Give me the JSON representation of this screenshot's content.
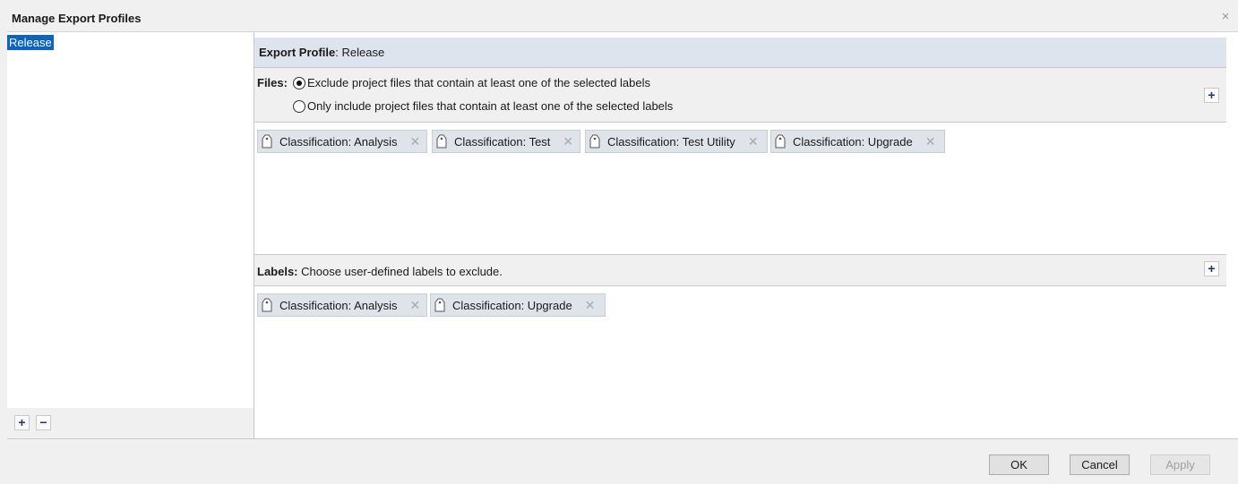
{
  "dialog": {
    "title": "Manage Export Profiles",
    "close_glyph": "×"
  },
  "profiles": {
    "items": [
      {
        "label": "Release",
        "selected": true
      }
    ],
    "add_glyph": "+",
    "remove_glyph": "−"
  },
  "export_profile": {
    "heading": "Export Profile",
    "separator": ":",
    "name": " Release"
  },
  "files": {
    "label": "Files:",
    "options": [
      {
        "label": "Exclude project files that contain at least one of the selected labels",
        "checked": true
      },
      {
        "label": "Only include project files that contain at least one of the selected labels",
        "checked": false
      }
    ],
    "add_glyph": "+",
    "chips": [
      {
        "label": "Classification: Analysis",
        "remove_glyph": "✕"
      },
      {
        "label": "Classification: Test",
        "remove_glyph": "✕"
      },
      {
        "label": "Classification: Test Utility",
        "remove_glyph": "✕"
      },
      {
        "label": "Classification: Upgrade",
        "remove_glyph": "✕"
      }
    ]
  },
  "labels": {
    "label": "Labels:",
    "description": " Choose user-defined labels to exclude.",
    "add_glyph": "+",
    "chips": [
      {
        "label": "Classification: Analysis",
        "remove_glyph": "✕"
      },
      {
        "label": "Classification: Upgrade",
        "remove_glyph": "✕"
      }
    ]
  },
  "buttons": {
    "ok": "OK",
    "cancel": "Cancel",
    "apply": "Apply"
  },
  "colors": {
    "selection": "#0a64c8",
    "header_bg": "#dde4ee",
    "chip_bg": "#dfe3ea",
    "add_icon": "#1c2f8f"
  },
  "icons": {
    "chip_icon": "tag-icon",
    "close": "close-icon"
  }
}
